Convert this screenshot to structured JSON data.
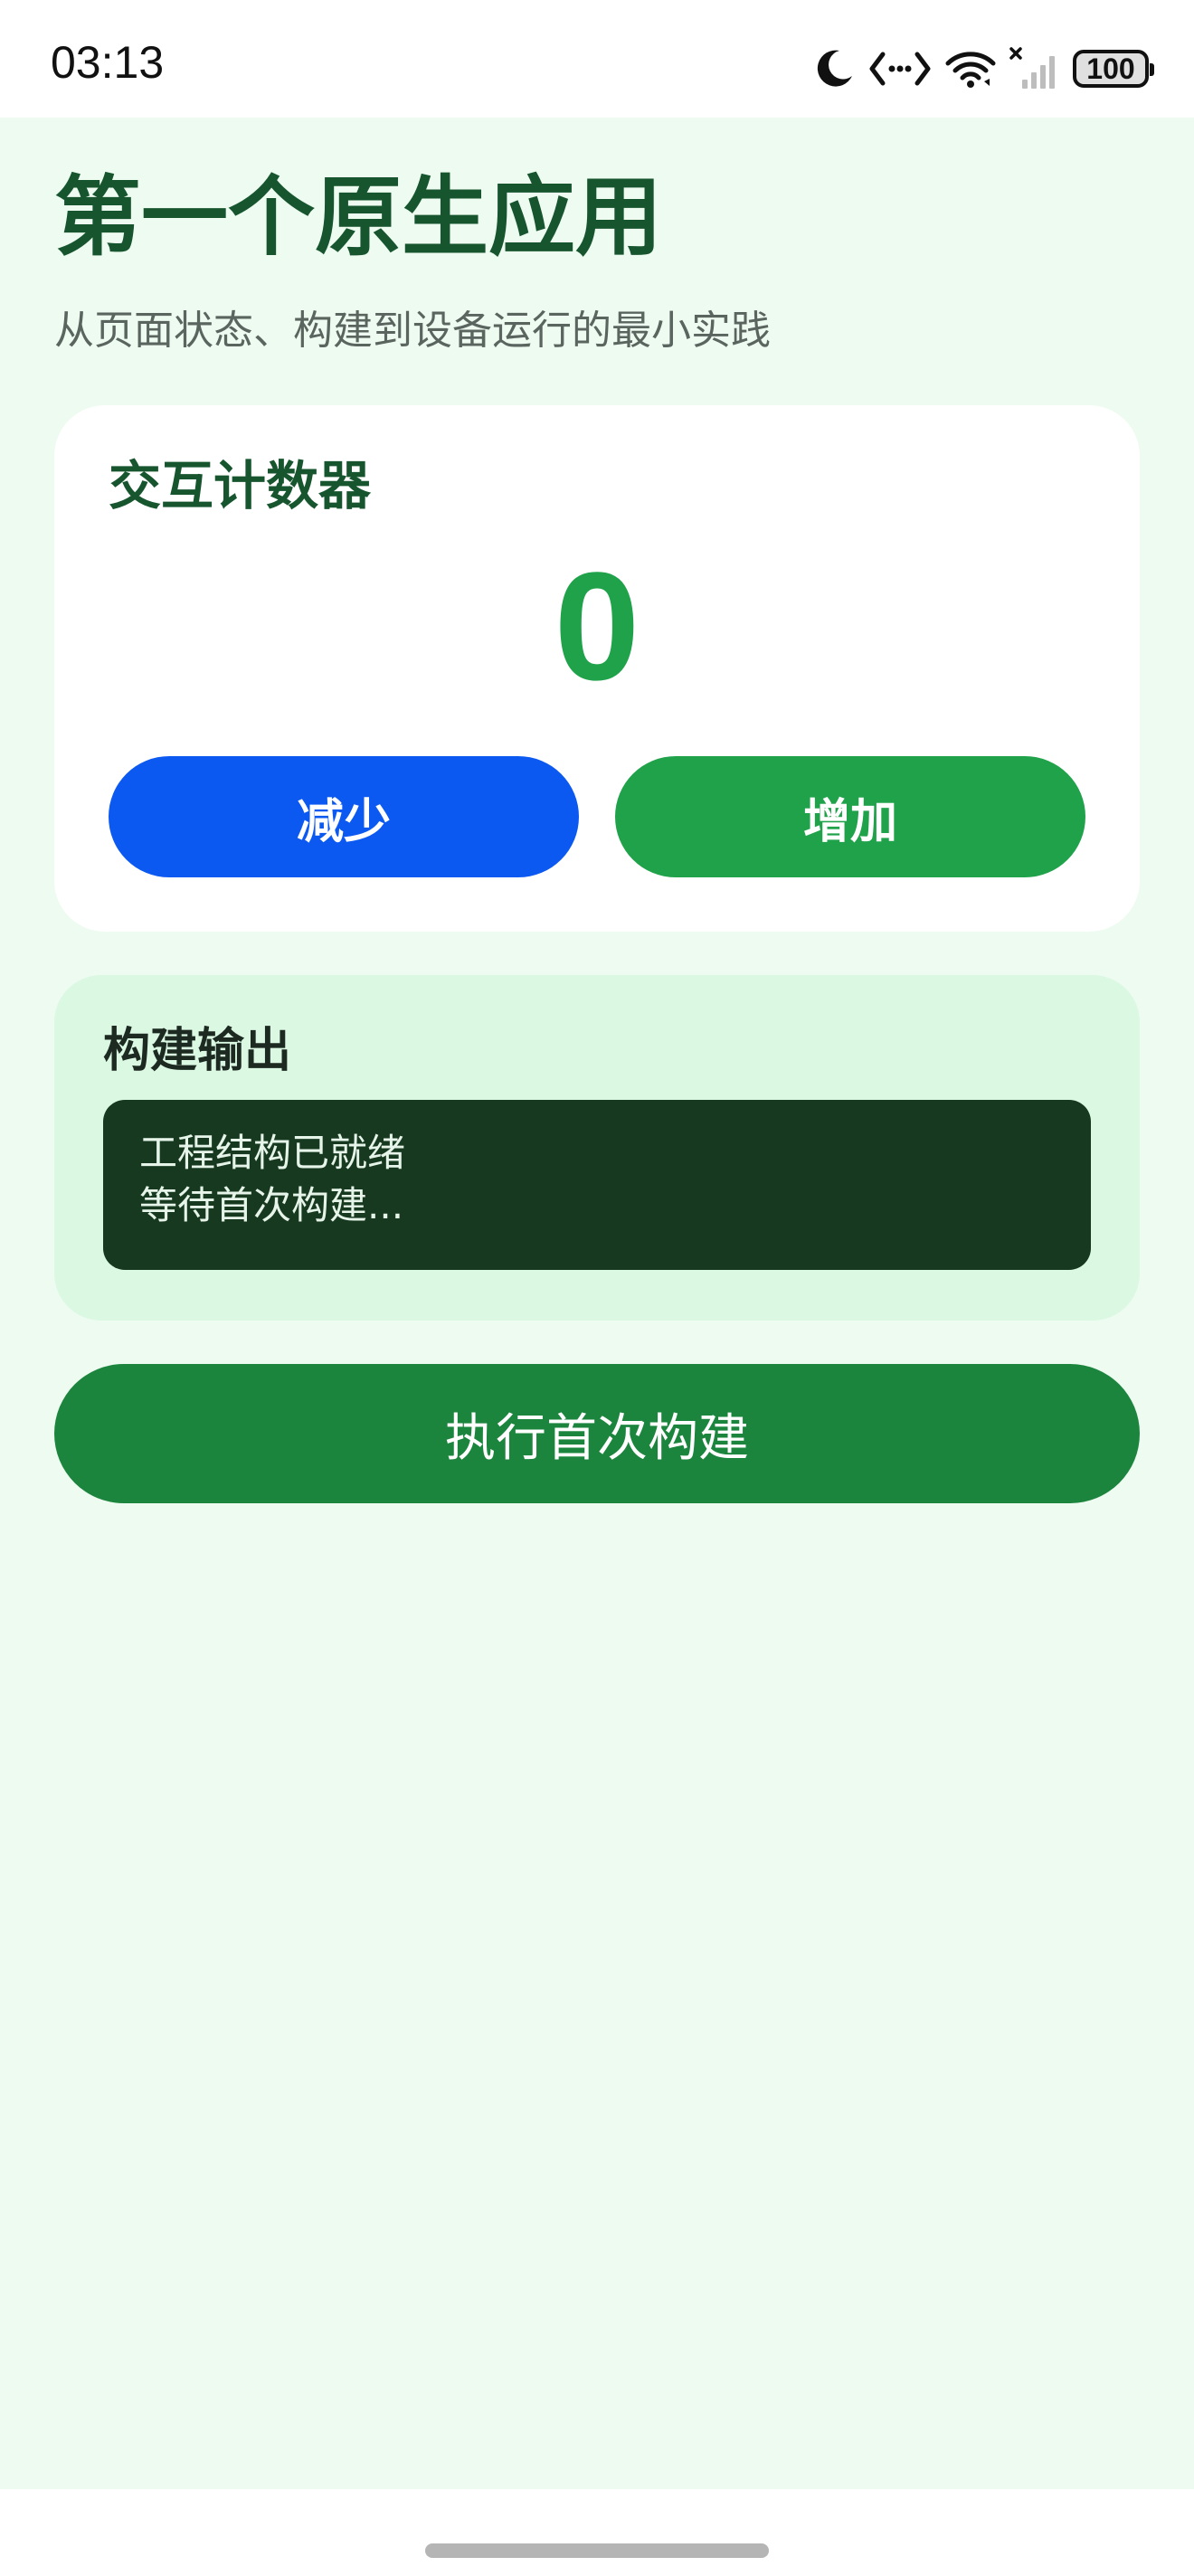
{
  "status_bar": {
    "time": "03:13",
    "battery": "100",
    "icons": [
      "moon-icon",
      "code-brackets-icon",
      "wifi-icon",
      "signal-no-sim-icon",
      "battery-icon"
    ]
  },
  "page": {
    "title": "第一个原生应用",
    "subtitle": "从页面状态、构建到设备运行的最小实践"
  },
  "counter": {
    "title": "交互计数器",
    "value": "0",
    "decrease_label": "减少",
    "increase_label": "增加"
  },
  "build_output": {
    "title": "构建输出",
    "lines": [
      "工程结构已就绪",
      "等待首次构建..."
    ]
  },
  "build_button_label": "执行首次构建",
  "colors": {
    "background": "#eefbf1",
    "title_green": "#17552f",
    "counter_green": "#1fa24a",
    "decrease_blue": "#0c59f2",
    "build_green": "#1b843d",
    "console_bg": "#17391f"
  }
}
